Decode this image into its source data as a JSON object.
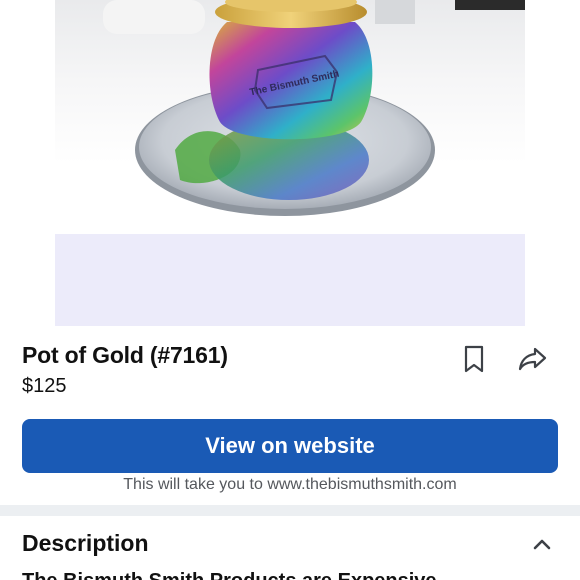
{
  "listing": {
    "title": "Pot of Gold (#7161)",
    "price": "$125"
  },
  "actions": {
    "save_icon": "bookmark-icon",
    "share_icon": "share-arrow-icon",
    "view_label": "View on website",
    "view_hint": "This will take you to www.thebismuthsmith.com"
  },
  "description": {
    "heading": "Description",
    "toggle_icon": "chevron-up-icon",
    "preview_text": "The Bismuth Smith Products are Expensive"
  },
  "image": {
    "embossed_text": "The Bismuth Smith"
  },
  "colors": {
    "primary_button": "#1a5ab5",
    "image_placeholder": "#ecebfa",
    "divider": "#eceff2"
  }
}
